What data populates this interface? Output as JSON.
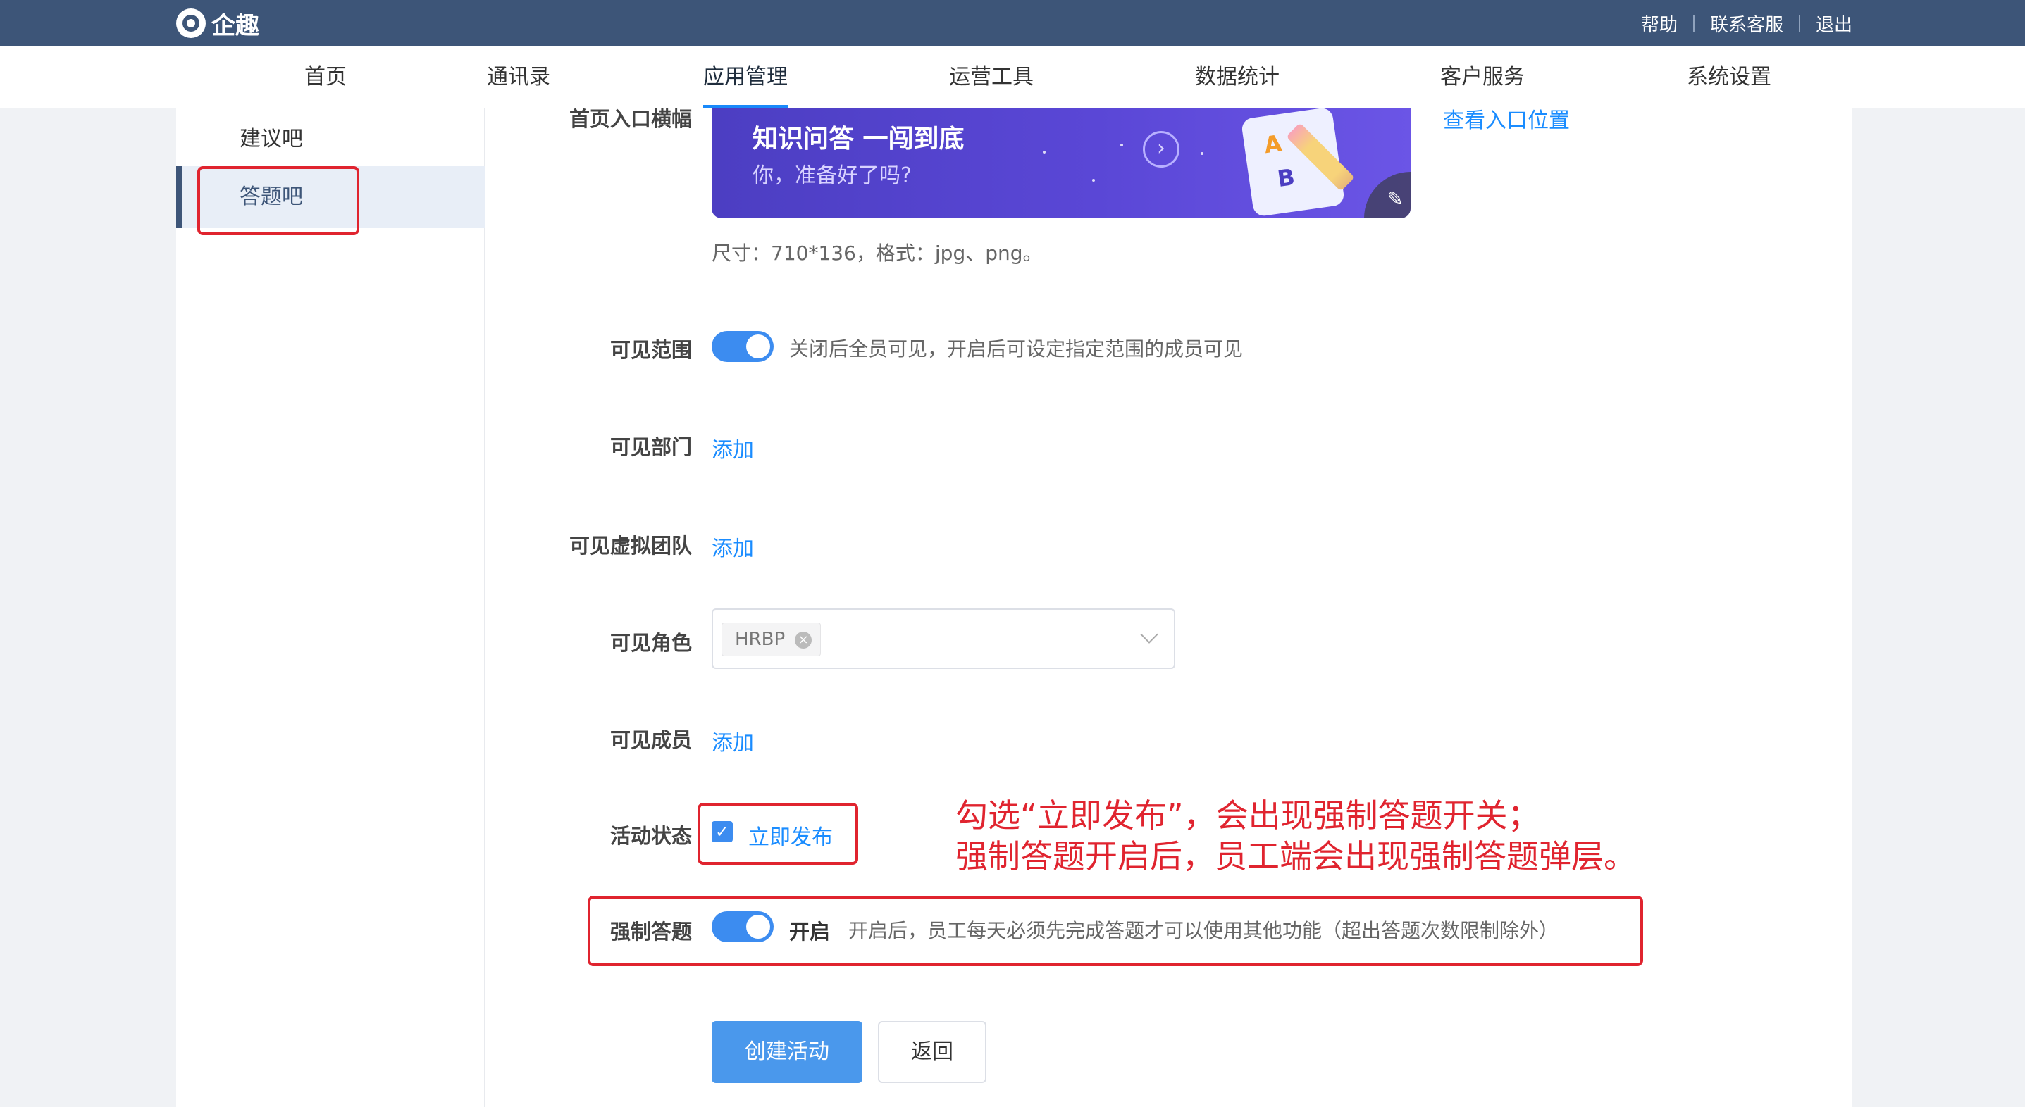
{
  "header": {
    "logo_text": "企趣",
    "links": [
      "帮助",
      "联系客服",
      "退出"
    ]
  },
  "nav": {
    "items": [
      "首页",
      "通讯录",
      "应用管理",
      "运营工具",
      "数据统计",
      "客户服务",
      "系统设置"
    ],
    "active": "应用管理"
  },
  "sidebar": {
    "items": [
      "建议吧",
      "答题吧"
    ],
    "active": "答题吧"
  },
  "form": {
    "banner_label": "首页入口横幅",
    "banner_title": "知识问答 一闯到底",
    "banner_subtitle": "你，准备好了吗?",
    "banner_view_link": "查看入口位置",
    "banner_hint": "尺寸：710*136，格式：jpg、png。",
    "visible_scope_label": "可见范围",
    "visible_scope_hint": "关闭后全员可见，开启后可设定指定范围的成员可见",
    "visible_dept_label": "可见部门",
    "visible_team_label": "可见虚拟团队",
    "visible_role_label": "可见角色",
    "role_tag": "HRBP",
    "visible_member_label": "可见成员",
    "add_link": "添加",
    "status_label": "活动状态",
    "publish_now": "立即发布",
    "force_label": "强制答题",
    "force_state": "开启",
    "force_hint": "开启后，员工每天必须先完成答题才可以使用其他功能（超出答题次数限制除外）",
    "create_button": "创建活动",
    "back_button": "返回"
  },
  "annotation": {
    "line1": "勾选“立即发布”，会出现强制答题开关；",
    "line2": "强制答题开启后，员工端会出现强制答题弹层。"
  },
  "colors": {
    "header_bg": "#3d5578",
    "accent": "#1a8cff",
    "annotation_red": "#e0242f"
  }
}
